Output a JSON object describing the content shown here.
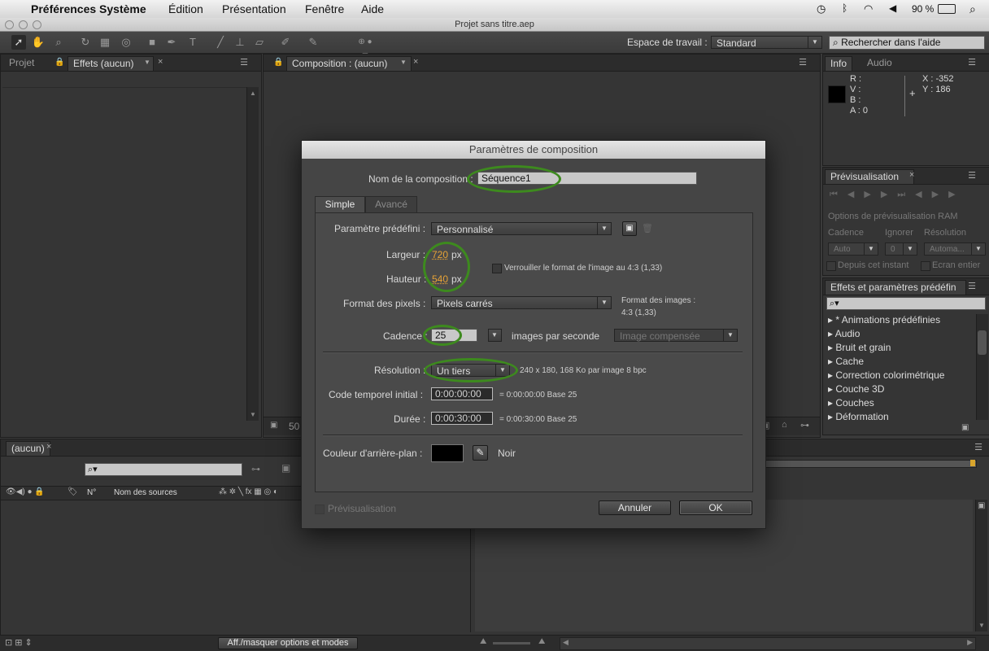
{
  "menubar": {
    "app": "Préférences Système",
    "items": [
      "Édition",
      "Présentation",
      "Fenêtre",
      "Aide"
    ],
    "battery": "90 %"
  },
  "window": {
    "title": "Projet sans titre.aep"
  },
  "toolbar": {
    "workspace_label": "Espace de travail :",
    "workspace_value": "Standard",
    "search_placeholder": "Rechercher dans l'aide"
  },
  "left_panel": {
    "tab_projet": "Projet",
    "tab_effets": "Effets (aucun)"
  },
  "comp_panel": {
    "tab": "Composition : (aucun)",
    "zoom": "50"
  },
  "info_panel": {
    "tab_info": "Info",
    "tab_audio": "Audio",
    "r": "R :",
    "v": "V :",
    "b": "B :",
    "a": "A : 0",
    "x": "X : -352",
    "y": "Y : 186"
  },
  "preview_panel": {
    "tab": "Prévisualisation",
    "ram_options": "Options de prévisualisation RAM",
    "cadence": "Cadence",
    "ignorer": "Ignorer",
    "resolution": "Résolution",
    "cadence_value": "Auto",
    "ignorer_value": "0",
    "resolution_value": "Automa...",
    "depuis": "Depuis cet instant",
    "ecran": "Ecran entier"
  },
  "effects_panel": {
    "tab": "Effets et paramètres prédéfin",
    "items": [
      "* Animations prédéfinies",
      "Audio",
      "Bruit et grain",
      "Cache",
      "Correction colorimétrique",
      "Couche 3D",
      "Couches",
      "Déformation"
    ]
  },
  "timeline": {
    "tab": "(aucun)",
    "col_n": "N°",
    "col_name": "Nom des sources",
    "toggle_label": "Aff./masquer options et modes"
  },
  "dialog": {
    "title": "Paramètres de composition",
    "name_label": "Nom de la composition :",
    "name_value": "Séquence1",
    "tab_simple": "Simple",
    "tab_avance": "Avancé",
    "preset_label": "Paramètre prédéfini :",
    "preset_value": "Personnalisé",
    "width_label": "Largeur :",
    "width_value": "720",
    "height_label": "Hauteur :",
    "height_value": "540",
    "px": "px",
    "lock_label": "Verrouiller le format de l'image au 4:3 (1,33)",
    "pixel_label": "Format des pixels :",
    "pixel_value": "Pixels carrés",
    "frame_format_label": "Format des images :",
    "frame_format_value": "4:3 (1,33)",
    "cadence_label": "Cadence :",
    "cadence_value": "25",
    "cadence_unit": "images par seconde",
    "cadence_mode": "Image compensée",
    "resolution_label": "Résolution :",
    "resolution_value": "Un tiers",
    "resolution_info": "240 x 180, 168 Ko par image 8 bpc",
    "timecode_label": "Code temporel initial :",
    "timecode_value": "0:00:00:00",
    "timecode_info": "= 0:00:00:00  Base 25",
    "duration_label": "Durée :",
    "duration_value": "0:00:30:00",
    "duration_info": "= 0:00:30:00  Base 25",
    "bg_label": "Couleur d'arrière-plan :",
    "bg_color": "#000000",
    "bg_name": "Noir",
    "preview_label": "Prévisualisation",
    "cancel": "Annuler",
    "ok": "OK"
  }
}
